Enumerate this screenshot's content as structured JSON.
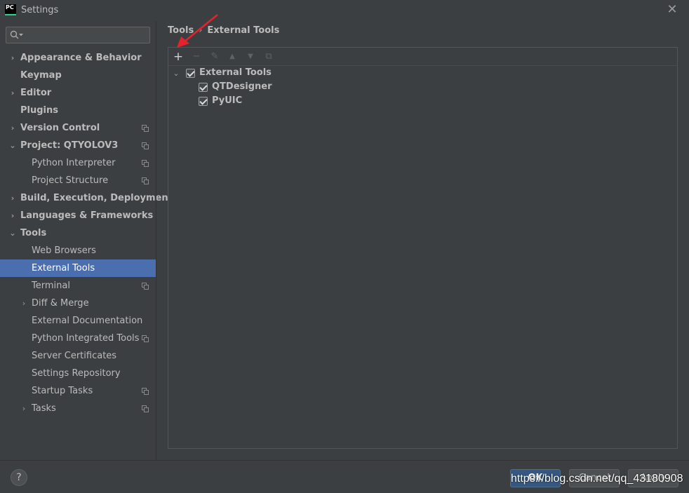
{
  "window": {
    "title": "Settings",
    "app_icon_text": "PC",
    "close_glyph": "✕"
  },
  "search": {
    "placeholder": "",
    "value": ""
  },
  "sidebar": {
    "items": [
      {
        "label": "Appearance & Behavior",
        "arrow": "›",
        "bold": true,
        "level": 0,
        "copy": false
      },
      {
        "label": "Keymap",
        "arrow": "",
        "bold": true,
        "level": 0,
        "copy": false
      },
      {
        "label": "Editor",
        "arrow": "›",
        "bold": true,
        "level": 0,
        "copy": false
      },
      {
        "label": "Plugins",
        "arrow": "",
        "bold": true,
        "level": 0,
        "copy": false
      },
      {
        "label": "Version Control",
        "arrow": "›",
        "bold": true,
        "level": 0,
        "copy": true
      },
      {
        "label": "Project: QTYOLOV3",
        "arrow": "⌄",
        "bold": true,
        "level": 0,
        "copy": true
      },
      {
        "label": "Python Interpreter",
        "arrow": "",
        "bold": false,
        "level": 1,
        "copy": true
      },
      {
        "label": "Project Structure",
        "arrow": "",
        "bold": false,
        "level": 1,
        "copy": true
      },
      {
        "label": "Build, Execution, Deployment",
        "arrow": "›",
        "bold": true,
        "level": 0,
        "copy": false
      },
      {
        "label": "Languages & Frameworks",
        "arrow": "›",
        "bold": true,
        "level": 0,
        "copy": false
      },
      {
        "label": "Tools",
        "arrow": "⌄",
        "bold": true,
        "level": 0,
        "copy": false
      },
      {
        "label": "Web Browsers",
        "arrow": "",
        "bold": false,
        "level": 1,
        "copy": false
      },
      {
        "label": "External Tools",
        "arrow": "",
        "bold": false,
        "level": 1,
        "copy": false,
        "selected": true
      },
      {
        "label": "Terminal",
        "arrow": "",
        "bold": false,
        "level": 1,
        "copy": true
      },
      {
        "label": "Diff & Merge",
        "arrow": "›",
        "bold": false,
        "level": 1,
        "copy": false
      },
      {
        "label": "External Documentation",
        "arrow": "",
        "bold": false,
        "level": 1,
        "copy": false
      },
      {
        "label": "Python Integrated Tools",
        "arrow": "",
        "bold": false,
        "level": 1,
        "copy": true
      },
      {
        "label": "Server Certificates",
        "arrow": "",
        "bold": false,
        "level": 1,
        "copy": false
      },
      {
        "label": "Settings Repository",
        "arrow": "",
        "bold": false,
        "level": 1,
        "copy": false
      },
      {
        "label": "Startup Tasks",
        "arrow": "",
        "bold": false,
        "level": 1,
        "copy": true
      },
      {
        "label": "Tasks",
        "arrow": "›",
        "bold": false,
        "level": 1,
        "copy": true
      }
    ]
  },
  "breadcrumb": {
    "parent": "Tools",
    "separator": "›",
    "current": "External Tools"
  },
  "toolbar": {
    "add": "+",
    "remove": "−",
    "edit": "✎",
    "move_up": "▲",
    "move_down": "▼",
    "copy": "⧉"
  },
  "tools_tree": {
    "group_label": "External Tools",
    "group_arrow": "⌄",
    "group_checked": true,
    "children": [
      {
        "label": "QTDesigner",
        "checked": true
      },
      {
        "label": "PyUIC",
        "checked": true
      }
    ]
  },
  "footer": {
    "help": "?",
    "ok": "OK",
    "cancel": "Cancel",
    "apply": "Apply"
  },
  "watermark": "https://blog.csdn.net/qq_43180908",
  "colors": {
    "background": "#3c3f41",
    "selection": "#4b6eaf",
    "default_button": "#365880",
    "annotation_arrow": "#e8222a"
  }
}
